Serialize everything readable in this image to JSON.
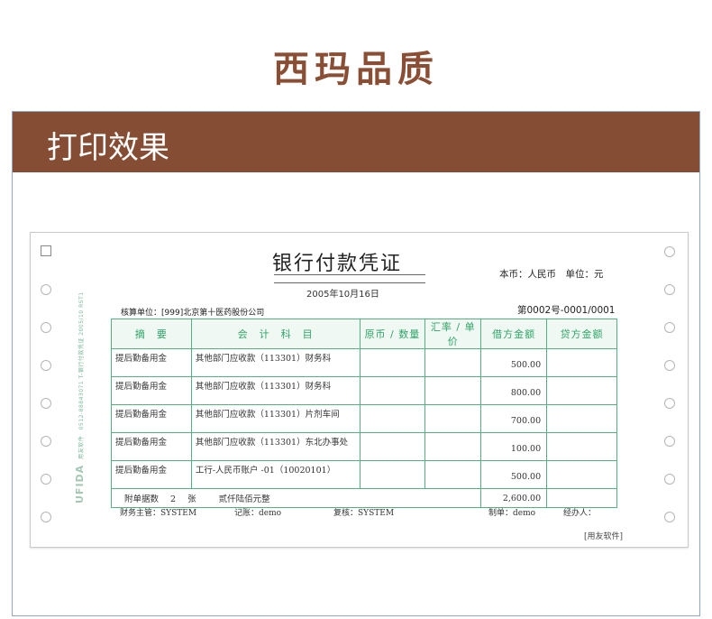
{
  "brand": {
    "title": "西玛品质"
  },
  "banner": {
    "title": "打印效果"
  },
  "voucher": {
    "title": "银行付款凭证",
    "date": "2005年10月16日",
    "currency": "本币：人民币　单位：元",
    "unit": "核算单位：[999]北京第十医药股份公司",
    "number": "第0002号-0001/0001",
    "strip_brand": "UFIDA",
    "strip_text": "用友软件　0512-88843071  T-银行付款凭证  2005/10  RST1",
    "headers": [
      "摘　要",
      "会　计　科　目",
      "原币 / 数量",
      "汇率 / 单价",
      "借方金额",
      "贷方金额"
    ],
    "rows": [
      {
        "summary": "提后勤备用金",
        "account": "其他部门应收款（113301）财务科",
        "debit": "500.00"
      },
      {
        "summary": "提后勤备用金",
        "account": "其他部门应收款（113301）财务科",
        "debit": "800.00"
      },
      {
        "summary": "提后勤备用金",
        "account": "其他部门应收款（113301）片剂车间",
        "debit": "700.00"
      },
      {
        "summary": "提后勤备用金",
        "account": "其他部门应收款（113301）东北办事处",
        "debit": "100.00"
      },
      {
        "summary": "提后勤备用金",
        "account": "工行-人民币账户 -01（10020101）",
        "debit": "500.00"
      }
    ],
    "total": {
      "attach_label": "附单据数",
      "attach_count": "2",
      "attach_unit": "张",
      "amount_words": "贰仟陆佰元整",
      "debit_total": "2,600.00"
    },
    "signatures": {
      "supervisor": "财务主管：SYSTEM",
      "bookkeeper": "记账：demo",
      "reviewer": "复核：SYSTEM",
      "preparer": "制单：demo",
      "handler": "经办人："
    },
    "software": "[用友软件]"
  }
}
